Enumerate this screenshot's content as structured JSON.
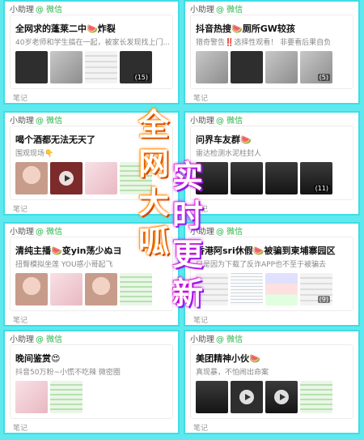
{
  "posts": [
    {
      "author": "小助理",
      "source": "@ 微信",
      "title": "全网求的蓬莱二中🍉炸裂",
      "subtitle": "40岁老师和学生搞在一起，被家长发现找上门...",
      "count": "(15)",
      "tag": "笔记"
    },
    {
      "author": "小助理",
      "source": "@ 微信",
      "title": "抖音热搜🍉厕所GW较孩",
      "subtitle": "猎奇警告‼️选择性观看！ 非要看后果自负",
      "count": "(5)",
      "tag": "笔记"
    },
    {
      "author": "小助理",
      "source": "@ 微信",
      "title": "喝个酒都无法无天了",
      "subtitle": "围观现场👇",
      "count": "",
      "tag": "笔记"
    },
    {
      "author": "小助理",
      "source": "@ 微信",
      "title": "问界车友群🍉",
      "subtitle": "雷达检测水泥柱封人",
      "count": "(11)",
      "tag": "笔记"
    },
    {
      "author": "小助理",
      "source": "@ 微信",
      "title": "清纯主播🍉变yin荡少ぬヨ",
      "subtitle": "扭臀模拟坐莲 YOU惑小哥起飞",
      "count": "",
      "tag": "笔记"
    },
    {
      "author": "小助理",
      "source": "@ 微信",
      "title": "香港阿sri休假🍉被骗到柬埔寨园区",
      "subtitle": "只是因为下载了反诈APP也不至于被骗去",
      "count": "(9)",
      "tag": "笔记"
    },
    {
      "author": "小助理",
      "source": "@ 微信",
      "title": "晚间鉴赏😍",
      "subtitle": "抖音50万粉~小慌不吃辣 微密圈",
      "count": "",
      "tag": "笔记"
    },
    {
      "author": "小助理",
      "source": "@ 微信",
      "title": "美团精神小伙🍉",
      "subtitle": "真现暴，不怕闹出命案",
      "count": "",
      "tag": "笔记"
    }
  ],
  "banner": {
    "left": [
      "全",
      "网",
      "大",
      "呱"
    ],
    "right": [
      "实",
      "时",
      "更",
      "新"
    ]
  }
}
